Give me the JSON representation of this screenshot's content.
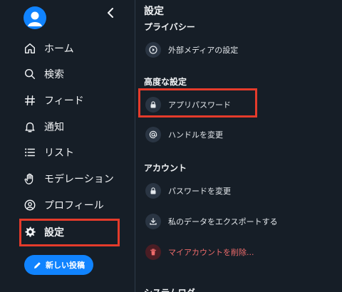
{
  "sidebar": {
    "nav": [
      {
        "label": "ホーム",
        "icon": "home-icon"
      },
      {
        "label": "検索",
        "icon": "search-icon"
      },
      {
        "label": "フィード",
        "icon": "hash-icon"
      },
      {
        "label": "通知",
        "icon": "bell-icon"
      },
      {
        "label": "リスト",
        "icon": "list-icon"
      },
      {
        "label": "モデレーション",
        "icon": "hand-icon"
      },
      {
        "label": "プロフィール",
        "icon": "person-circle-icon"
      },
      {
        "label": "設定",
        "icon": "gear-icon",
        "active": true
      }
    ],
    "compose_label": "新しい投稿"
  },
  "main": {
    "title": "設定",
    "sections": [
      {
        "title": "プライバシー",
        "items": [
          {
            "label": "外部メディアの設定",
            "icon": "play-circle-icon"
          }
        ]
      },
      {
        "title": "高度な設定",
        "items": [
          {
            "label": "アプリパスワード",
            "icon": "lock-icon"
          },
          {
            "label": "ハンドルを変更",
            "icon": "at-icon"
          }
        ]
      },
      {
        "title": "アカウント",
        "items": [
          {
            "label": "パスワードを変更",
            "icon": "lock-icon"
          },
          {
            "label": "私のデータをエクスポートする",
            "icon": "download-icon"
          },
          {
            "label": "マイアカウントを削除...",
            "icon": "trash-icon",
            "danger": true
          }
        ]
      }
    ],
    "next_section_title": "システムログ"
  },
  "colors": {
    "background": "#161e27",
    "accent": "#1083fe",
    "highlight": "#e53b2b",
    "danger": "#ef6b6b"
  }
}
